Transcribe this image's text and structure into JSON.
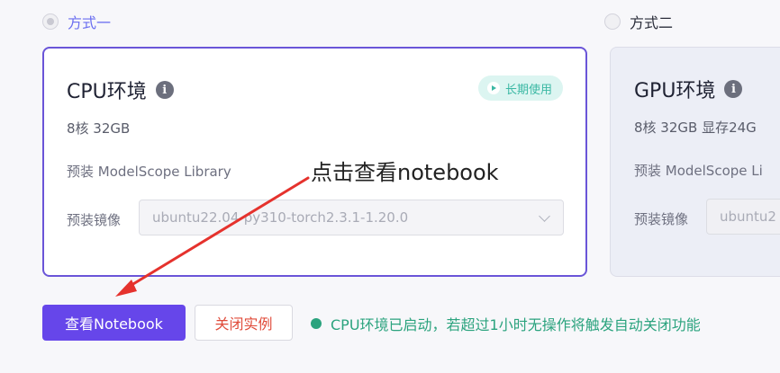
{
  "options": {
    "option1_label": "方式一",
    "option2_label": "方式二"
  },
  "cpu_card": {
    "title": "CPU环境",
    "badge": "长期使用",
    "spec": "8核 32GB",
    "library": "预装 ModelScope Library",
    "mirror_label": "预装镜像",
    "mirror_value": "ubuntu22.04-py310-torch2.3.1-1.20.0"
  },
  "gpu_card": {
    "title": "GPU环境",
    "spec": "8核 32GB 显存24G",
    "library": "预装 ModelScope Li",
    "mirror_label": "预装镜像",
    "mirror_value": "ubuntu2"
  },
  "annotation": {
    "text": "点击查看notebook"
  },
  "actions": {
    "view_notebook": "查看Notebook",
    "close_instance": "关闭实例"
  },
  "status": {
    "text": "CPU环境已启动，若超过1小时无操作将触发自动关闭功能"
  },
  "colors": {
    "accent": "#6646ea",
    "card_border": "#6a55d8",
    "danger": "#e04b3a",
    "success": "#2ba37e",
    "annotation_arrow": "#e5322d"
  },
  "icons": {
    "info": "info-icon",
    "play": "play-icon",
    "chevron": "chevron-down-icon"
  }
}
